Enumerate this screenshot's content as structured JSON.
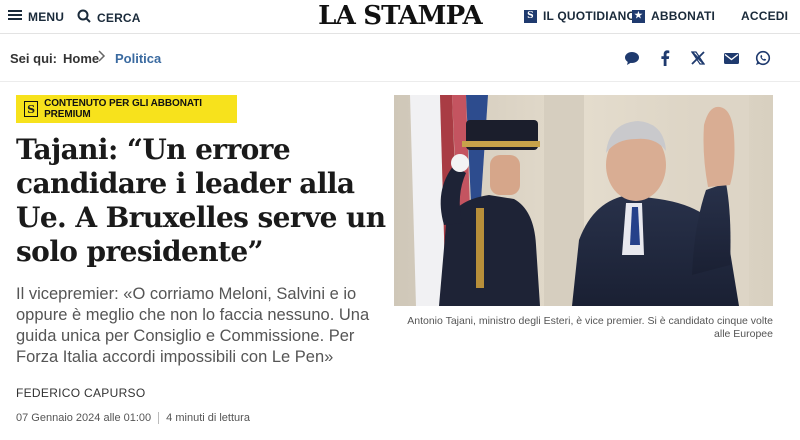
{
  "header": {
    "menu_label": "MENU",
    "search_label": "CERCA",
    "logo": "LA STAMPA",
    "quotidiano_label": "IL QUOTIDIANO",
    "abbonati_label": "ABBONATI",
    "accedi_label": "ACCEDI"
  },
  "breadcrumb": {
    "prefix": "Sei qui:",
    "items": [
      "Home",
      "Politica"
    ]
  },
  "share_icons": [
    "comment-icon",
    "facebook-icon",
    "x-icon",
    "mail-icon",
    "whatsapp-icon"
  ],
  "article": {
    "badge_letter": "S",
    "badge_text": "CONTENUTO PER GLI ABBONATI PREMIUM",
    "headline": "Tajani: “Un errore candidare i leader alla Ue. A Bruxelles serve un solo presidente”",
    "summary": "Il vicepremier: «O corriamo Meloni, Salvini e io oppure è meglio che non lo faccia nessuno. Una guida unica per Consiglio e Commissione. Per Forza Italia accordi impossibili con Le Pen»",
    "author": "FEDERICO CAPURSO",
    "date": "07 Gennaio 2024 alle 01:00",
    "reading_time": "4 minuti di lettura",
    "photo_caption": "Antonio Tajani, ministro degli Esteri, è vice premier. Si è candidato cinque volte alle Europee"
  },
  "colors": {
    "badge_yellow": "#f7e21c",
    "brand_navy": "#1f3a6e",
    "link_blue": "#3a6aa0"
  }
}
